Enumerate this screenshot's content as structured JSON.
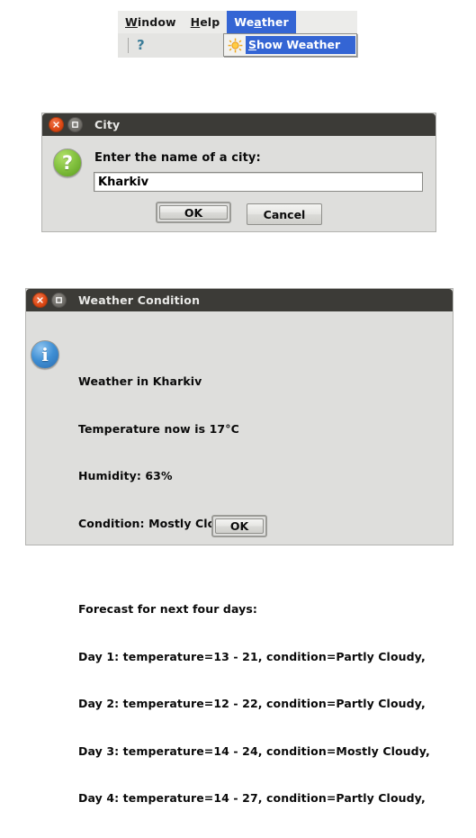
{
  "menubar": {
    "items": [
      {
        "label": "Window",
        "mnemonic": "W",
        "active": false
      },
      {
        "label": "Help",
        "mnemonic": "H",
        "active": false
      },
      {
        "label": "Weather",
        "mnemonic": "a",
        "active": true
      }
    ],
    "menu_highlight_color": "#3465d4"
  },
  "toolbar": {
    "help_icon": "question-mark-icon",
    "help_glyph": "?"
  },
  "dropdown": {
    "icon": "sun-icon",
    "item_label_before": "S",
    "item_label_after": "how Weather",
    "item_label_full": "Show Weather",
    "selected": true
  },
  "city_dialog": {
    "title": "City",
    "icon": "question-circle-icon",
    "icon_glyph": "?",
    "prompt": "Enter the name of a city:",
    "input": {
      "value": "Kharkiv",
      "placeholder": ""
    },
    "buttons": [
      {
        "label": "OK",
        "focused": true
      },
      {
        "label": "Cancel",
        "focused": false
      }
    ],
    "window_buttons": {
      "close": "close-icon",
      "maximize": "maximize-icon"
    }
  },
  "weather_dialog": {
    "title": "Weather Condition",
    "icon": "info-circle-icon",
    "icon_glyph": "i",
    "lines": {
      "l1": "Weather in Kharkiv",
      "l2": "Temperature now is 17°C",
      "l3": "Humidity: 63%",
      "l4": "Condition: Mostly Cloudy",
      "l5": "Forecast for next four days:",
      "l6": "Day 1: temperature=13 - 21, condition=Partly Cloudy,",
      "l7": "Day 2: temperature=12 - 22, condition=Partly Cloudy,",
      "l8": "Day 3: temperature=14 - 24, condition=Mostly Cloudy,",
      "l9": "Day 4: temperature=14 - 27, condition=Partly Cloudy,"
    },
    "forecast": [
      {
        "day": "Day 1",
        "temp_min": 13,
        "temp_max": 21,
        "condition": "Partly Cloudy"
      },
      {
        "day": "Day 2",
        "temp_min": 12,
        "temp_max": 22,
        "condition": "Partly Cloudy"
      },
      {
        "day": "Day 3",
        "temp_min": 14,
        "temp_max": 24,
        "condition": "Mostly Cloudy"
      },
      {
        "day": "Day 4",
        "temp_min": 14,
        "temp_max": 27,
        "condition": "Partly Cloudy"
      }
    ],
    "current": {
      "city": "Kharkiv",
      "temperature": "17°C",
      "humidity": "63%",
      "condition": "Mostly Cloudy"
    },
    "buttons": [
      {
        "label": "OK",
        "focused": true
      }
    ],
    "window_buttons": {
      "close": "close-icon",
      "maximize": "maximize-icon"
    }
  }
}
